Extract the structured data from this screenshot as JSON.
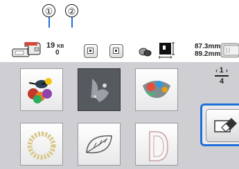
{
  "callouts": {
    "one": "①",
    "two": "②"
  },
  "memory": {
    "value": "19",
    "unit": "KB",
    "count": "0"
  },
  "size": {
    "width": "87.3mm",
    "height": "89.2mm"
  },
  "pager": {
    "current": "1",
    "total": "4"
  },
  "icons": {
    "machine": "sewing-machine-icon",
    "thread": "thread-spool-icon",
    "pattern_size": "pattern-size-icon",
    "embroidery_frame": "embroidery-frame-icon",
    "eraser": "eraser-icon"
  },
  "colors": {
    "accent": "#1f6fd8",
    "panel": "#cfcfd3",
    "selected_tile": "#555a5f"
  }
}
